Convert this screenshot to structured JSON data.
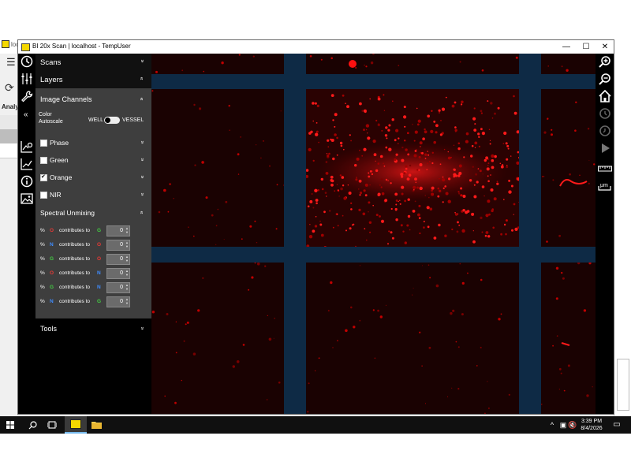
{
  "background_app": {
    "title_fragment": "loc",
    "analysis_fragment": "Analy"
  },
  "window": {
    "title": "BI 20x Scan | localhost - TempUser",
    "controls": {
      "minimize": "—",
      "maximize": "☐",
      "close": "✕"
    }
  },
  "rail_icons": [
    "clock-icon",
    "sliders-icon",
    "wrench-icon",
    "chart-gear-icon",
    "chart-line-icon",
    "info-icon",
    "image-icon"
  ],
  "panel": {
    "scans_label": "Scans",
    "layers_label": "Layers",
    "image_channels_label": "Image Channels",
    "collapse_symbol": "«",
    "color_autoscale_label": "Color Autoscale",
    "toggle_left": "WELL",
    "toggle_right": "VESSEL",
    "channels": [
      {
        "label": "Phase",
        "checked": false
      },
      {
        "label": "Green",
        "checked": false
      },
      {
        "label": "Orange",
        "checked": true
      },
      {
        "label": "NIR",
        "checked": false
      }
    ],
    "spectral_unmixing_label": "Spectral Unmixing",
    "unmixing_rows": [
      {
        "pct": "%",
        "source": "O",
        "source_color": "#e53935",
        "text": "contributes to",
        "target": "G",
        "target_color": "#43c943",
        "value": "0"
      },
      {
        "pct": "%",
        "source": "N",
        "source_color": "#3f8cff",
        "text": "contributes to",
        "target": "O",
        "target_color": "#e53935",
        "value": "0"
      },
      {
        "pct": "%",
        "source": "G",
        "source_color": "#43c943",
        "text": "contributes to",
        "target": "O",
        "target_color": "#e53935",
        "value": "0"
      },
      {
        "pct": "%",
        "source": "O",
        "source_color": "#e53935",
        "text": "contributes to",
        "target": "N",
        "target_color": "#3f8cff",
        "value": "0"
      },
      {
        "pct": "%",
        "source": "G",
        "source_color": "#43c943",
        "text": "contributes to",
        "target": "N",
        "target_color": "#3f8cff",
        "value": "0"
      },
      {
        "pct": "%",
        "source": "N",
        "source_color": "#3f8cff",
        "text": "contributes to",
        "target": "G",
        "target_color": "#43c943",
        "value": "0"
      }
    ],
    "tools_label": "Tools",
    "chevron_down": "»",
    "chevron_up": "«"
  },
  "right_toolbar": [
    "zoom-in-icon",
    "zoom-out-icon",
    "home-icon",
    "history-forward-icon",
    "history-back-icon",
    "play-icon",
    "ruler-icon",
    "scale-bar-icon"
  ],
  "scale_label": "μm",
  "taskbar": {
    "time": "3:39 PM",
    "date": "8/4/2026"
  },
  "colors": {
    "fluorescence": "#e00000",
    "grid_lines": "#0e2a45",
    "panel_gray": "#3e3e3e"
  }
}
